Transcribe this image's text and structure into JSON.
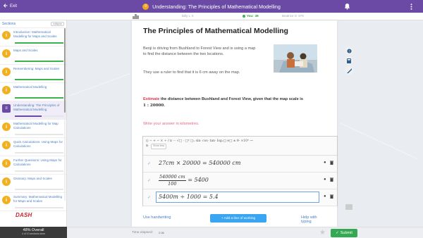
{
  "topbar": {
    "exit_label": "Exit",
    "title": "Understanding: The Principles of Mathematical Modelling"
  },
  "scores": {
    "left_name": "Billy L",
    "left_value": "5",
    "you_label": "You:",
    "you_value": "39",
    "right_name": "Beatrice O",
    "right_value": "979"
  },
  "sidebar": {
    "heading": "Sections",
    "collapse_label": "collapse",
    "items": [
      {
        "label": "Introduction: Mathematical Modelling for Maps and Scales",
        "icon": "info-icon",
        "progress": 1.0
      },
      {
        "label": "Maps and Scales",
        "icon": "info-icon",
        "progress": 1.0
      },
      {
        "label": "Remembering: Maps and Scales",
        "icon": "info-icon",
        "progress": 1.0
      },
      {
        "label": "Mathematical Modelling",
        "icon": "info-icon",
        "progress": 1.0
      },
      {
        "label": "Understanding: The Principles of Mathematical Modelling",
        "icon": "list-icon",
        "progress": 0.55
      },
      {
        "label": "Mathematical Modelling for Map Calculations",
        "icon": "info-icon",
        "progress": 0
      },
      {
        "label": "Quick Calculations: Using Maps for Calculations",
        "icon": "info-icon",
        "progress": 0
      },
      {
        "label": "Further Questions: Using Maps for Calculations",
        "icon": "info-icon",
        "progress": 0
      },
      {
        "label": "Glossary: Maps and Scales",
        "icon": "info-icon",
        "progress": 0
      },
      {
        "label": "Summary: Mathematical Modelling for Maps and Scales",
        "icon": "info-icon",
        "progress": 0
      }
    ],
    "logo_text": "DASH",
    "overall": "48% Overall",
    "overall_sub": "4 of 10 sections done"
  },
  "lesson": {
    "title": "The Principles of Mathematical Modelling",
    "para1": "Benji is driving from Bushland to Forest View and is using a map to find the distance between the two locations.",
    "para2": "They use a ruler to find that it is 6 cm away on the map.",
    "estimate_word": "Estimate",
    "estimate_rest": " the distance between Bushland and Forest View, given that the map scale is",
    "scale": "1 : 20000",
    "answer_prompt": "Write your answer in kilometres."
  },
  "toolbar": {
    "symbols": "()  −  +  −  ×  ÷  /  π   ···  √□  ·  □ⁿ  □ₓ  sin·  cos·  tan·  logₓ□  e□  ±  θ·  ×10ⁿ  →·",
    "symbols2": "$·",
    "show_less": "Show less"
  },
  "workings": [
    {
      "text": "27cm × 20000  =  540000 cm"
    },
    {
      "num": "540000 cm",
      "den": "100",
      "rest": " = 5400"
    },
    {
      "text": "5400m ÷ 1000  =  5.4"
    }
  ],
  "footer": {
    "use_handwriting": "Use handwriting",
    "add_line": "+ Add a line of working",
    "help_typing": "Help with typing"
  },
  "status": {
    "time_label": "Time elapsed:",
    "time_value": "2:36",
    "submit_label": "Submit"
  },
  "colors": {
    "purple": "#6b4aa6",
    "green": "#3cb44b",
    "blue_link": "#4a7fc1",
    "highlight_red": "#d9344f"
  }
}
